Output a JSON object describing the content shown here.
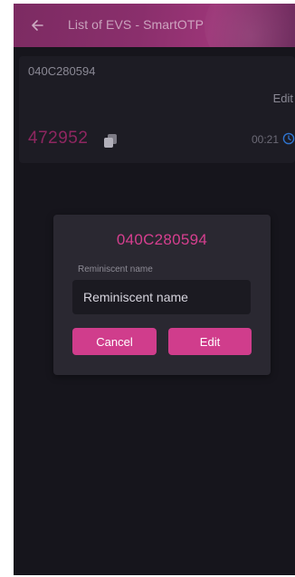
{
  "appbar": {
    "title": "List of EVS - SmartOTP",
    "back_icon": "arrow-left-icon"
  },
  "card": {
    "id": "040C280594",
    "edit_label": "Edit",
    "otp_code": "472952",
    "timer": "00:21",
    "copy_icon": "copy-icon",
    "clock_icon": "clock-icon"
  },
  "dialog": {
    "title": "040C280594",
    "field_label": "Reminiscent name",
    "field_value": "",
    "field_placeholder": "Reminiscent name",
    "cancel_label": "Cancel",
    "edit_label": "Edit"
  },
  "colors": {
    "accent": "#d03d8c",
    "background": "#16151c",
    "card": "#1d1c24",
    "dialog": "#2a2831"
  }
}
